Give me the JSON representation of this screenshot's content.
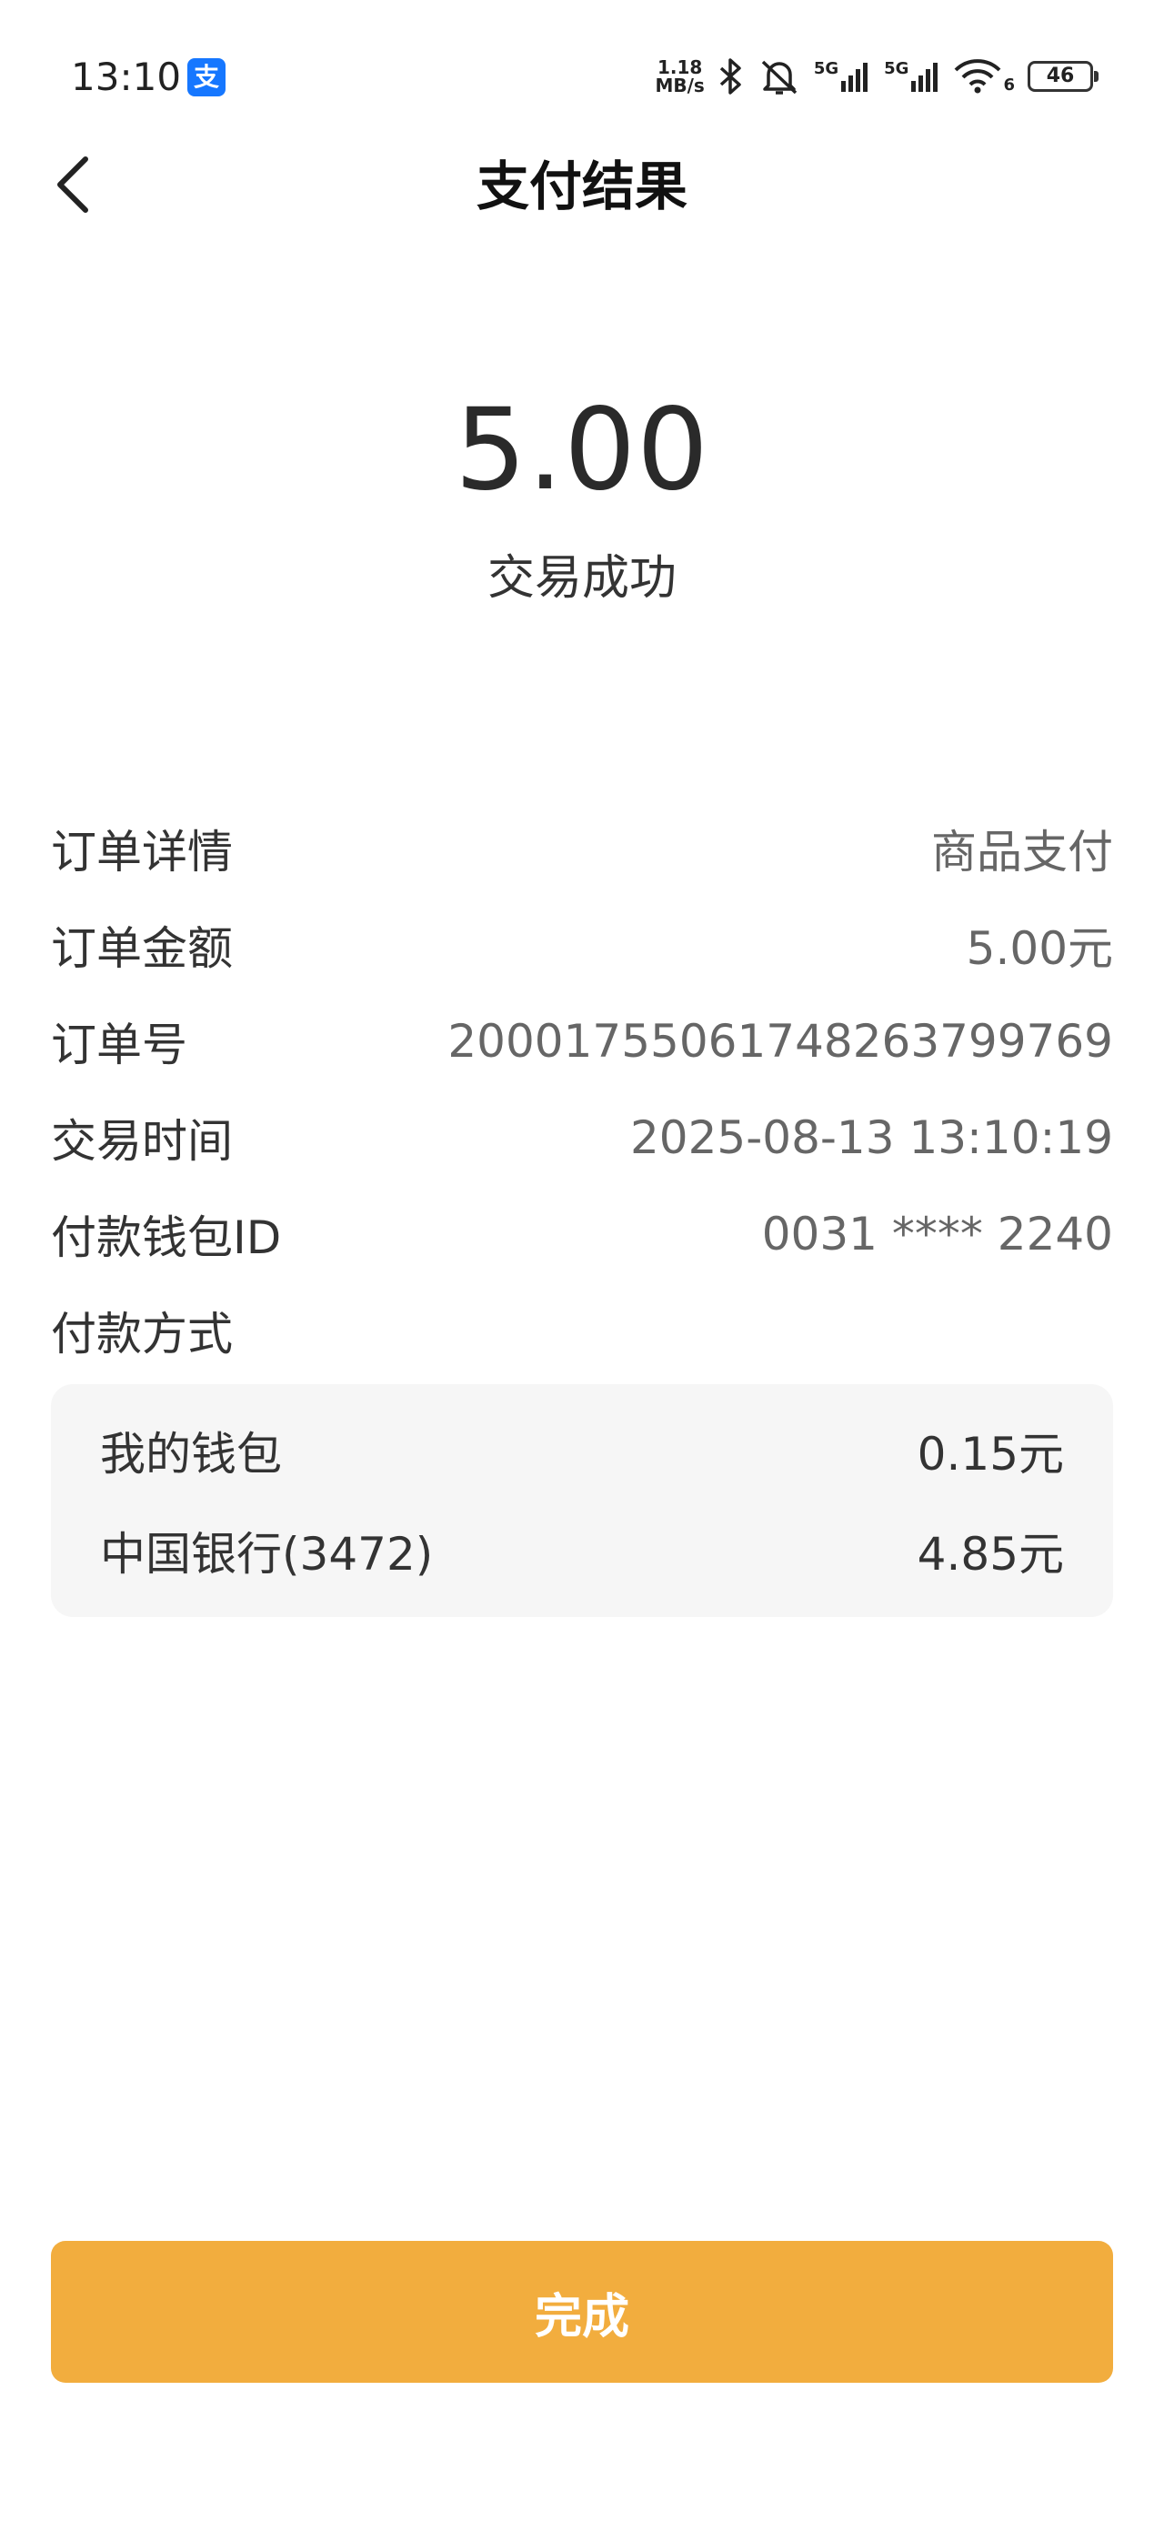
{
  "status_bar": {
    "time": "13:10",
    "app_icon_glyph": "支",
    "net_speed_value": "1.18",
    "net_speed_unit": "MB/s",
    "sim1_label": "5G",
    "sim2_label": "5G",
    "wifi_label": "6",
    "battery": "46",
    "icons": [
      "bluetooth-icon",
      "mute-icon",
      "signal-icon",
      "wifi-icon",
      "battery-icon"
    ]
  },
  "header": {
    "title": "支付结果",
    "back_icon": "chevron-left-icon"
  },
  "result": {
    "amount": "5.00",
    "status": "交易成功"
  },
  "details": [
    {
      "label": "订单详情",
      "value": "商品支付"
    },
    {
      "label": "订单金额",
      "value": "5.00元"
    },
    {
      "label": "订单号",
      "value": "20001755061748263799769"
    },
    {
      "label": "交易时间",
      "value": "2025-08-13 13:10:19"
    },
    {
      "label": "付款钱包ID",
      "value": "0031 **** 2240"
    }
  ],
  "payment_method": {
    "label": "付款方式",
    "items": [
      {
        "name": "我的钱包",
        "amount": "0.15元"
      },
      {
        "name": "中国银行(3472)",
        "amount": "4.85元"
      }
    ]
  },
  "actions": {
    "done_label": "完成"
  },
  "colors": {
    "accent": "#f2ad3e",
    "app_icon": "#1677ff",
    "pay_box_bg": "#f6f6f6"
  }
}
